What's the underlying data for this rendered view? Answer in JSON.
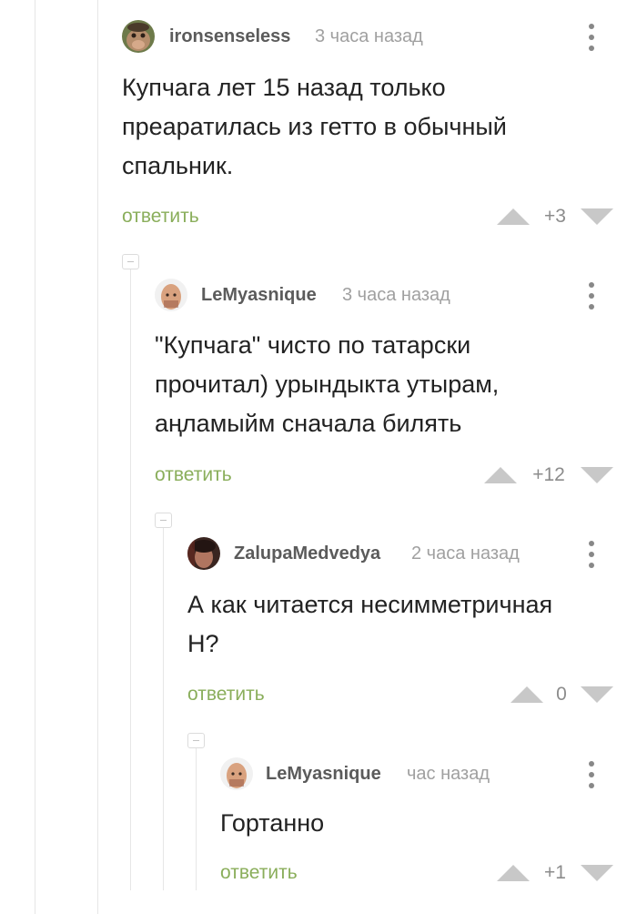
{
  "comments": [
    {
      "author": "ironsenseless",
      "time": "3 часа назад",
      "lines": [
        "Купчага лет 15 назад только",
        "преаратилась из гетто в обычный",
        "спальник."
      ],
      "reply_label": "ответить",
      "rating": "+3"
    },
    {
      "author": "LeMyasnique",
      "time": "3 часа назад",
      "lines": [
        "\"Купчага\" чисто по татарски",
        "прочитал) урындыкта утырам,",
        "аңламыйм сначала билять"
      ],
      "reply_label": "ответить",
      "rating": "+12"
    },
    {
      "author": "ZalupaMedvedya",
      "time": "2 часа назад",
      "lines": [
        "А как читается несимметричная",
        "Н?"
      ],
      "reply_label": "ответить",
      "rating": "0"
    },
    {
      "author": "LeMyasnique",
      "time": "час назад",
      "lines": [
        "Гортанно"
      ],
      "reply_label": "ответить",
      "rating": "+1"
    }
  ],
  "icons": {
    "more": "more-vertical-icon",
    "upvote": "upvote-arrow-icon",
    "downvote": "downvote-arrow-icon",
    "collapse": "collapse-thread-icon"
  },
  "colors": {
    "reply_link": "#8aae5b",
    "vote_arrow": "#c8c8c8",
    "author": "#5b5b5b",
    "timestamp": "#a0a0a0"
  }
}
